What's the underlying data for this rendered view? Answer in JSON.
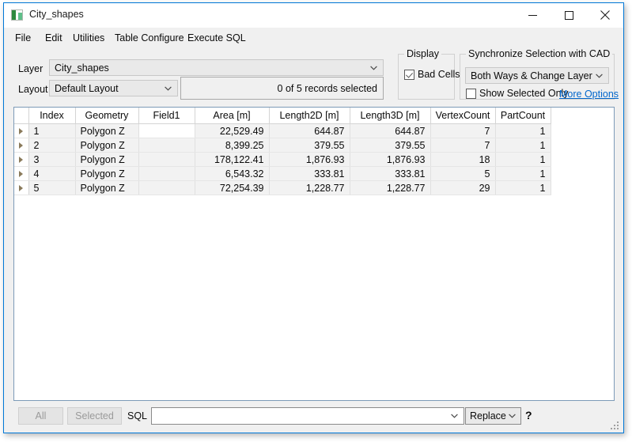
{
  "window": {
    "title": "City_shapes",
    "icon": "app-window-icon",
    "controls": {
      "minimize": "minimize-icon",
      "maximize": "maximize-icon",
      "close": "close-icon"
    }
  },
  "menubar": {
    "items": [
      {
        "label": "File"
      },
      {
        "label": "Edit"
      },
      {
        "label": "Utilities"
      },
      {
        "label": "Table Configure"
      },
      {
        "label": "Execute SQL"
      }
    ]
  },
  "toolbar": {
    "layer_label": "Layer",
    "layer_value": "City_shapes",
    "layout_label": "Layout",
    "layout_value": "Default Layout",
    "records_status": "0 of 5 records selected"
  },
  "display_group": {
    "title": "Display",
    "bad_cells_label": "Bad Cells",
    "bad_cells_checked": true
  },
  "sync_group": {
    "title": "Synchronize Selection with CAD",
    "mode_value": "Both Ways & Change Layer",
    "show_selected_only_label": "Show Selected Only",
    "show_selected_only_checked": false,
    "more_options_label": "More Options",
    "link_color": "#0066cc"
  },
  "table": {
    "columns": [
      "Index",
      "Geometry",
      "Field1",
      "Area [m]",
      "Length2D [m]",
      "Length3D [m]",
      "VertexCount",
      "PartCount"
    ],
    "rows": [
      {
        "index": "1",
        "geometry": "Polygon Z",
        "field1": "",
        "area": "22,529.49",
        "length2d": "644.87",
        "length3d": "644.87",
        "vertexcount": "7",
        "partcount": "1"
      },
      {
        "index": "2",
        "geometry": "Polygon Z",
        "field1": "",
        "area": "8,399.25",
        "length2d": "379.55",
        "length3d": "379.55",
        "vertexcount": "7",
        "partcount": "1"
      },
      {
        "index": "3",
        "geometry": "Polygon Z",
        "field1": "",
        "area": "178,122.41",
        "length2d": "1,876.93",
        "length3d": "1,876.93",
        "vertexcount": "18",
        "partcount": "1"
      },
      {
        "index": "4",
        "geometry": "Polygon Z",
        "field1": "",
        "area": "6,543.32",
        "length2d": "333.81",
        "length3d": "333.81",
        "vertexcount": "5",
        "partcount": "1"
      },
      {
        "index": "5",
        "geometry": "Polygon Z",
        "field1": "",
        "area": "72,254.39",
        "length2d": "1,228.77",
        "length3d": "1,228.77",
        "vertexcount": "29",
        "partcount": "1"
      }
    ]
  },
  "bottombar": {
    "all_label": "All",
    "selected_label": "Selected",
    "sql_label": "SQL",
    "sql_value": "",
    "replace_value": "Replace",
    "help_label": "?"
  }
}
